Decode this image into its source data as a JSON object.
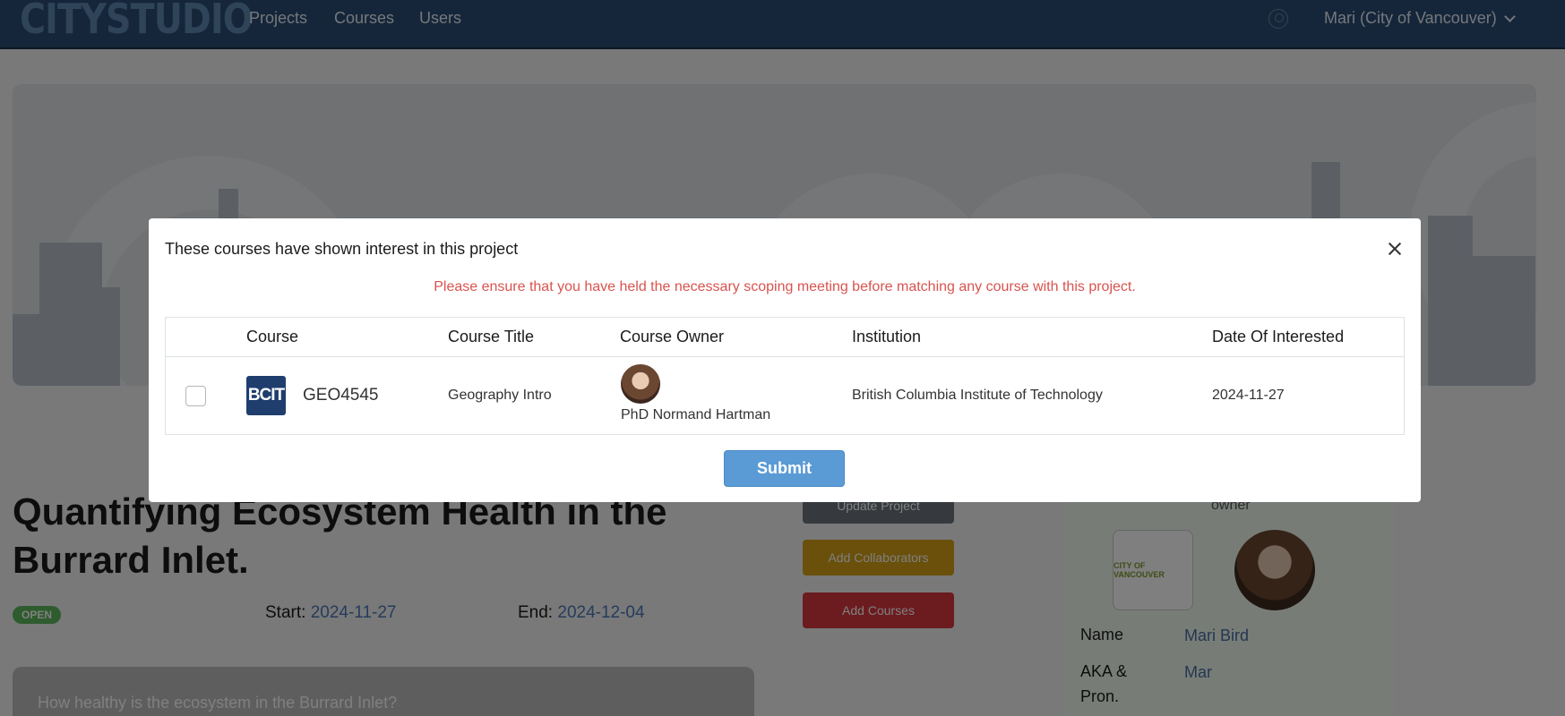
{
  "nav": {
    "logo": "CITYSTUDIO",
    "links": [
      "Projects",
      "Courses",
      "Users"
    ],
    "user_menu": "Mari (City of Vancouver)"
  },
  "project": {
    "title": "Quantifying Ecosystem Health in the Burrard Inlet.",
    "status": "OPEN",
    "start_label": "Start:",
    "start_date": "2024-11-27",
    "end_label": "End:",
    "end_date": "2024-12-04",
    "question": "How healthy is the ecosystem in the Burrard Inlet?"
  },
  "actions": {
    "update": "Update Project",
    "collaborators": "Add Collaborators",
    "add_courses": "Add Courses"
  },
  "owner_card": {
    "label": "owner",
    "org_logo_text": "CITY OF VANCOUVER",
    "name_label": "Name",
    "name_value": "Mari Bird",
    "aka_label_line1": "AKA &",
    "aka_label_line2": "Pron.",
    "aka_value": "Mar"
  },
  "modal": {
    "title": "These courses have shown interest in this project",
    "warning": "Please ensure that you have held the necessary scoping meeting before matching any course with this project.",
    "columns": {
      "course": "Course",
      "title": "Course Title",
      "owner": "Course Owner",
      "institution": "Institution",
      "date": "Date Of Interested"
    },
    "rows": [
      {
        "logo_text": "BCIT",
        "course": "GEO4545",
        "title": "Geography Intro",
        "owner": "PhD Normand Hartman",
        "institution": "British Columbia Institute of Technology",
        "date": "2024-11-27",
        "checked": false
      }
    ],
    "submit": "Submit"
  },
  "colors": {
    "navbar": "#2b4c75",
    "warning": "#d9534f",
    "submit": "#5b9bd5",
    "status_open": "#5cb85c"
  }
}
